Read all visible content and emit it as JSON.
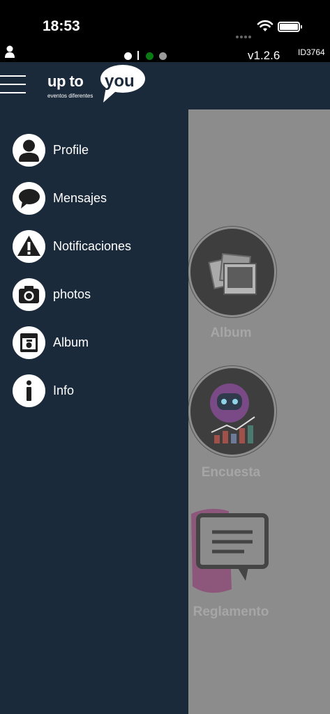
{
  "status_bar": {
    "time": "18:53",
    "icons": [
      "cellular-signal-icon",
      "wifi-icon",
      "battery-icon"
    ]
  },
  "info_bar": {
    "version": "v1.2.6",
    "device_id": "ID3764",
    "indicators": [
      {
        "name": "indicator-white",
        "color": "#ffffff"
      },
      {
        "name": "indicator-green",
        "color": "#0a7a14"
      },
      {
        "name": "indicator-grey",
        "color": "#9a9a9a"
      }
    ]
  },
  "header": {
    "logo_text_left": "up to",
    "logo_text_bubble": "you",
    "logo_tagline": "eventos diferentes"
  },
  "drawer": {
    "items": [
      {
        "label": "Profile",
        "icon": "profile-icon"
      },
      {
        "label": "Mensajes",
        "icon": "chat-bubble-icon"
      },
      {
        "label": "Notificaciones",
        "icon": "warning-icon"
      },
      {
        "label": "photos",
        "icon": "camera-icon"
      },
      {
        "label": "Album",
        "icon": "album-icon"
      },
      {
        "label": "Info",
        "icon": "info-icon"
      }
    ]
  },
  "background_tiles": [
    {
      "label": "Album",
      "icon": "photos-stack-icon"
    },
    {
      "label": "Encuesta",
      "icon": "robot-chart-icon"
    },
    {
      "label": "Reglamento",
      "icon": "document-chat-icon"
    }
  ],
  "colors": {
    "drawer_bg": "#1b2a3a",
    "overlay_bg": "#8c8c8c",
    "status_bg": "#000000",
    "accent_green": "#0a7a14"
  }
}
